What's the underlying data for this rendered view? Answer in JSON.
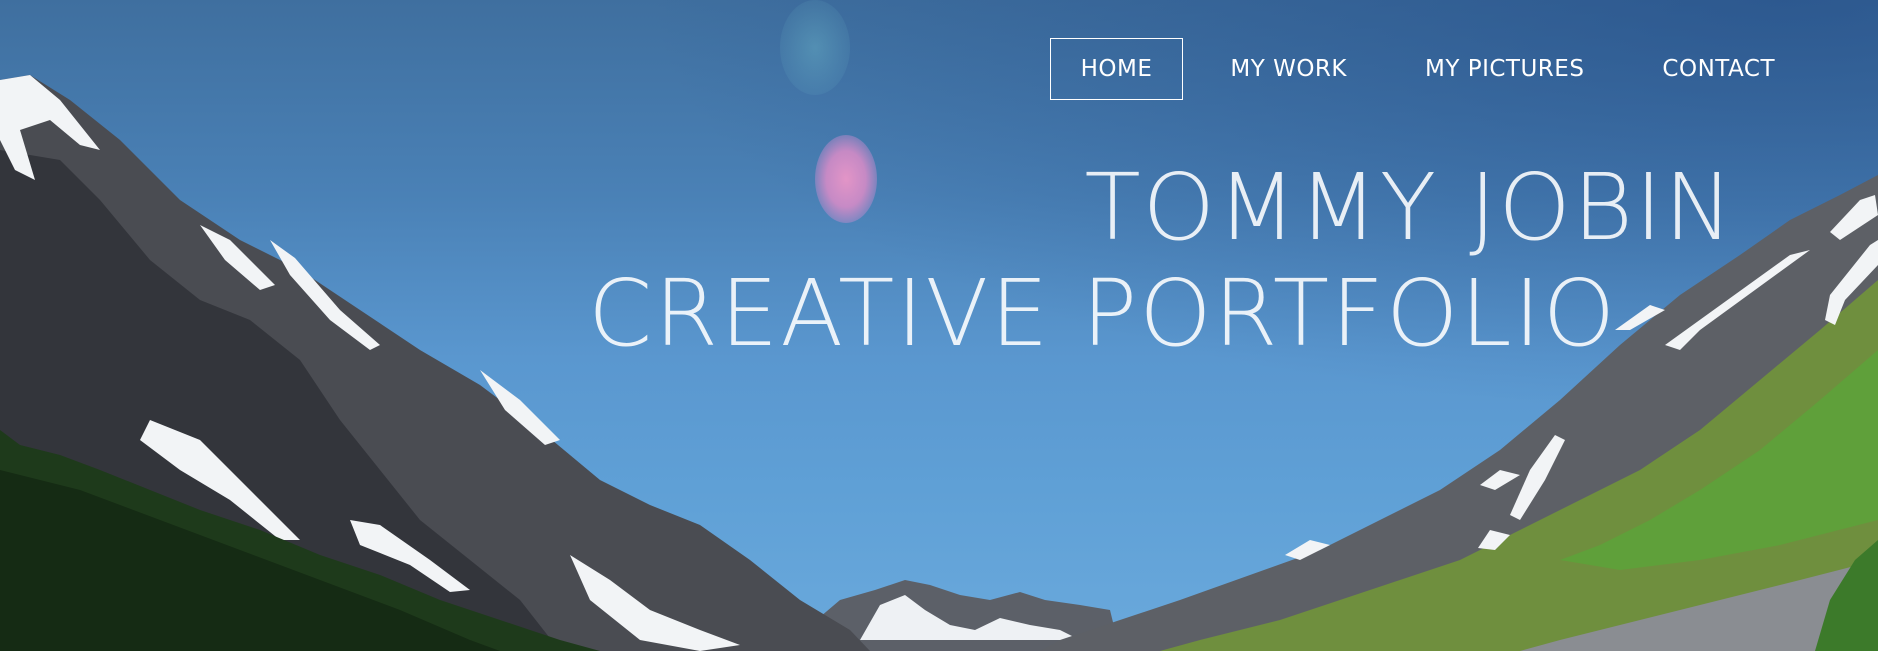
{
  "nav": {
    "items": [
      {
        "label": "HOME",
        "active": true
      },
      {
        "label": "MY WORK",
        "active": false
      },
      {
        "label": "MY PICTURES",
        "active": false
      },
      {
        "label": "CONTACT",
        "active": false
      }
    ]
  },
  "hero": {
    "title": "TOMMY JOBIN",
    "subtitle": "CREATIVE PORTFOLIO"
  },
  "colors": {
    "sky": "#4a81b6",
    "nav_text": "#ffffff",
    "title_text": "#f0f2f5",
    "forest": "#1f3a1c",
    "meadow": "#5f9a35",
    "rock": "#4b4d52",
    "snow": "#f4f6f8"
  }
}
